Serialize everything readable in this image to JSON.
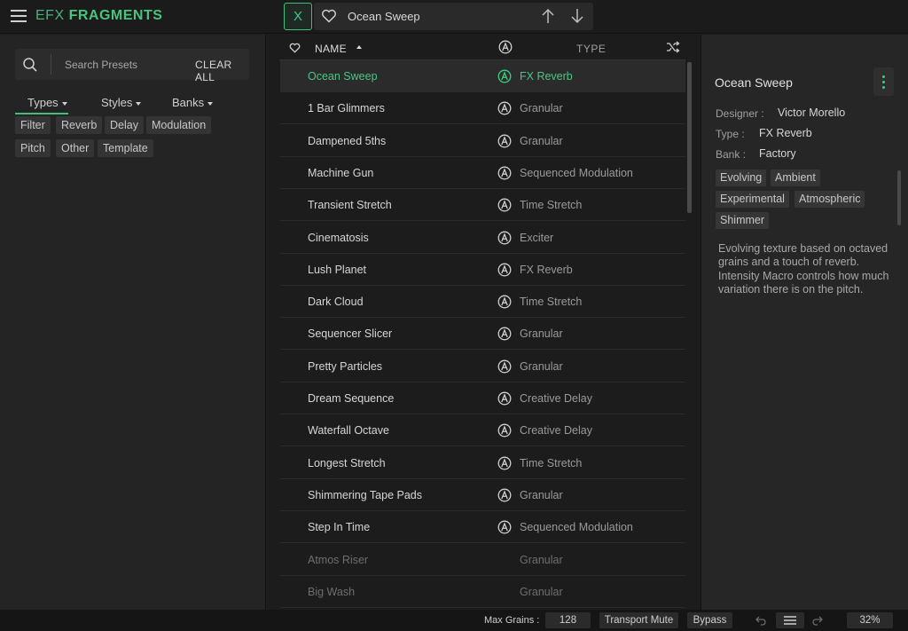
{
  "app": {
    "brand_part1": "EFX",
    "brand_part2": "FRAGMENTS",
    "close_label": "X",
    "current_preset": "Ocean Sweep"
  },
  "browser": {
    "search_placeholder": "Search Presets",
    "clear_all": "CLEAR ALL",
    "tabs": [
      "Types",
      "Styles",
      "Banks"
    ],
    "active_tab": "Types",
    "type_filters": [
      "Filter",
      "Reverb",
      "Delay",
      "Modulation",
      "Pitch",
      "Other",
      "Template"
    ]
  },
  "list": {
    "header_name": "NAME",
    "header_type": "TYPE",
    "rows": [
      {
        "name": "Ocean Sweep",
        "type": "FX Reverb",
        "selected": true,
        "dim": false
      },
      {
        "name": "1 Bar Glimmers",
        "type": "Granular",
        "selected": false,
        "dim": false
      },
      {
        "name": "Dampened 5ths",
        "type": "Granular",
        "selected": false,
        "dim": false
      },
      {
        "name": "Machine Gun",
        "type": "Sequenced Modulation",
        "selected": false,
        "dim": false
      },
      {
        "name": "Transient Stretch",
        "type": "Time Stretch",
        "selected": false,
        "dim": false
      },
      {
        "name": "Cinematosis",
        "type": "Exciter",
        "selected": false,
        "dim": false
      },
      {
        "name": "Lush Planet",
        "type": "FX Reverb",
        "selected": false,
        "dim": false
      },
      {
        "name": "Dark Cloud",
        "type": "Time Stretch",
        "selected": false,
        "dim": false
      },
      {
        "name": "Sequencer Slicer",
        "type": "Granular",
        "selected": false,
        "dim": false
      },
      {
        "name": "Pretty Particles",
        "type": "Granular",
        "selected": false,
        "dim": false
      },
      {
        "name": "Dream Sequence",
        "type": "Creative Delay",
        "selected": false,
        "dim": false
      },
      {
        "name": "Waterfall Octave",
        "type": "Creative Delay",
        "selected": false,
        "dim": false
      },
      {
        "name": "Longest Stretch",
        "type": "Time Stretch",
        "selected": false,
        "dim": false
      },
      {
        "name": "Shimmering Tape Pads",
        "type": "Granular",
        "selected": false,
        "dim": false
      },
      {
        "name": "Step In Time",
        "type": "Sequenced Modulation",
        "selected": false,
        "dim": false
      },
      {
        "name": "Atmos Riser",
        "type": "Granular",
        "selected": false,
        "dim": true
      },
      {
        "name": "Big Wash",
        "type": "Granular",
        "selected": false,
        "dim": true
      }
    ]
  },
  "details": {
    "title": "Ocean Sweep",
    "designer_label": "Designer :",
    "designer": "Victor Morello",
    "type_label": "Type :",
    "type": "FX Reverb",
    "bank_label": "Bank :",
    "bank": "Factory",
    "tags": [
      "Evolving",
      "Ambient",
      "Experimental",
      "Atmospheric",
      "Shimmer"
    ],
    "description": "Evolving texture based on octaved grains and a touch of reverb. Intensity Macro controls how much variation there is on the pitch."
  },
  "statusbar": {
    "max_grains_label": "Max Grains :",
    "max_grains": "128",
    "transport_mute": "Transport Mute",
    "bypass": "Bypass",
    "zoom": "32%"
  },
  "colors": {
    "accent": "#3fcf82",
    "background": "#1e1e1e"
  },
  "icons": [
    "menu-icon",
    "heart-icon",
    "arrow-up-icon",
    "arrow-down-icon",
    "search-icon",
    "arturia-icon",
    "shuffle-icon",
    "kebab-icon",
    "undo-icon",
    "redo-icon",
    "list-icon"
  ]
}
